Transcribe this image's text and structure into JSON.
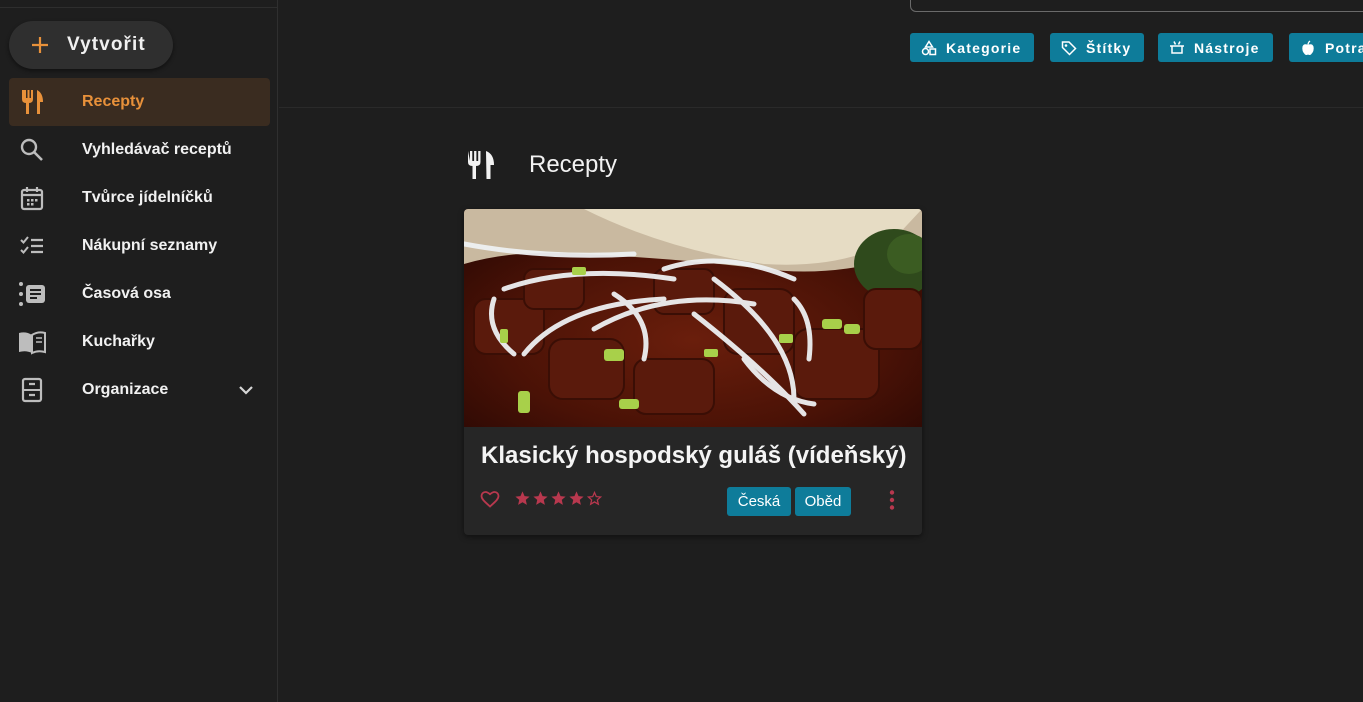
{
  "sidebar": {
    "create_label": "Vytvořit",
    "items": [
      {
        "label": "Recepty",
        "icon": "silverware-icon",
        "active": true
      },
      {
        "label": "Vyhledávač receptů",
        "icon": "search-icon"
      },
      {
        "label": "Tvůrce jídelníčků",
        "icon": "calendar-icon"
      },
      {
        "label": "Nákupní seznamy",
        "icon": "checklist-icon"
      },
      {
        "label": "Časová osa",
        "icon": "timeline-icon"
      },
      {
        "label": "Kuchařky",
        "icon": "book-icon"
      },
      {
        "label": "Organizace",
        "icon": "cabinet-icon",
        "expandable": true
      }
    ]
  },
  "toolbar": {
    "chips": [
      {
        "label": "Kategorie",
        "icon": "shapes-icon"
      },
      {
        "label": "Štítky",
        "icon": "tag-icon"
      },
      {
        "label": "Nástroje",
        "icon": "pot-icon"
      },
      {
        "label": "Potraviny",
        "icon": "apple-icon"
      }
    ]
  },
  "main": {
    "page_title": "Recepty",
    "recipes": [
      {
        "title": "Klasický hospodský guláš (vídeňský)",
        "rating": 4,
        "rating_max": 5,
        "tags": [
          "Česká",
          "Oběd"
        ]
      }
    ]
  },
  "colors": {
    "accent": "#e8913a",
    "chip": "#0e7c9a",
    "heart": "#b8384e",
    "background": "#1e1e1e"
  }
}
